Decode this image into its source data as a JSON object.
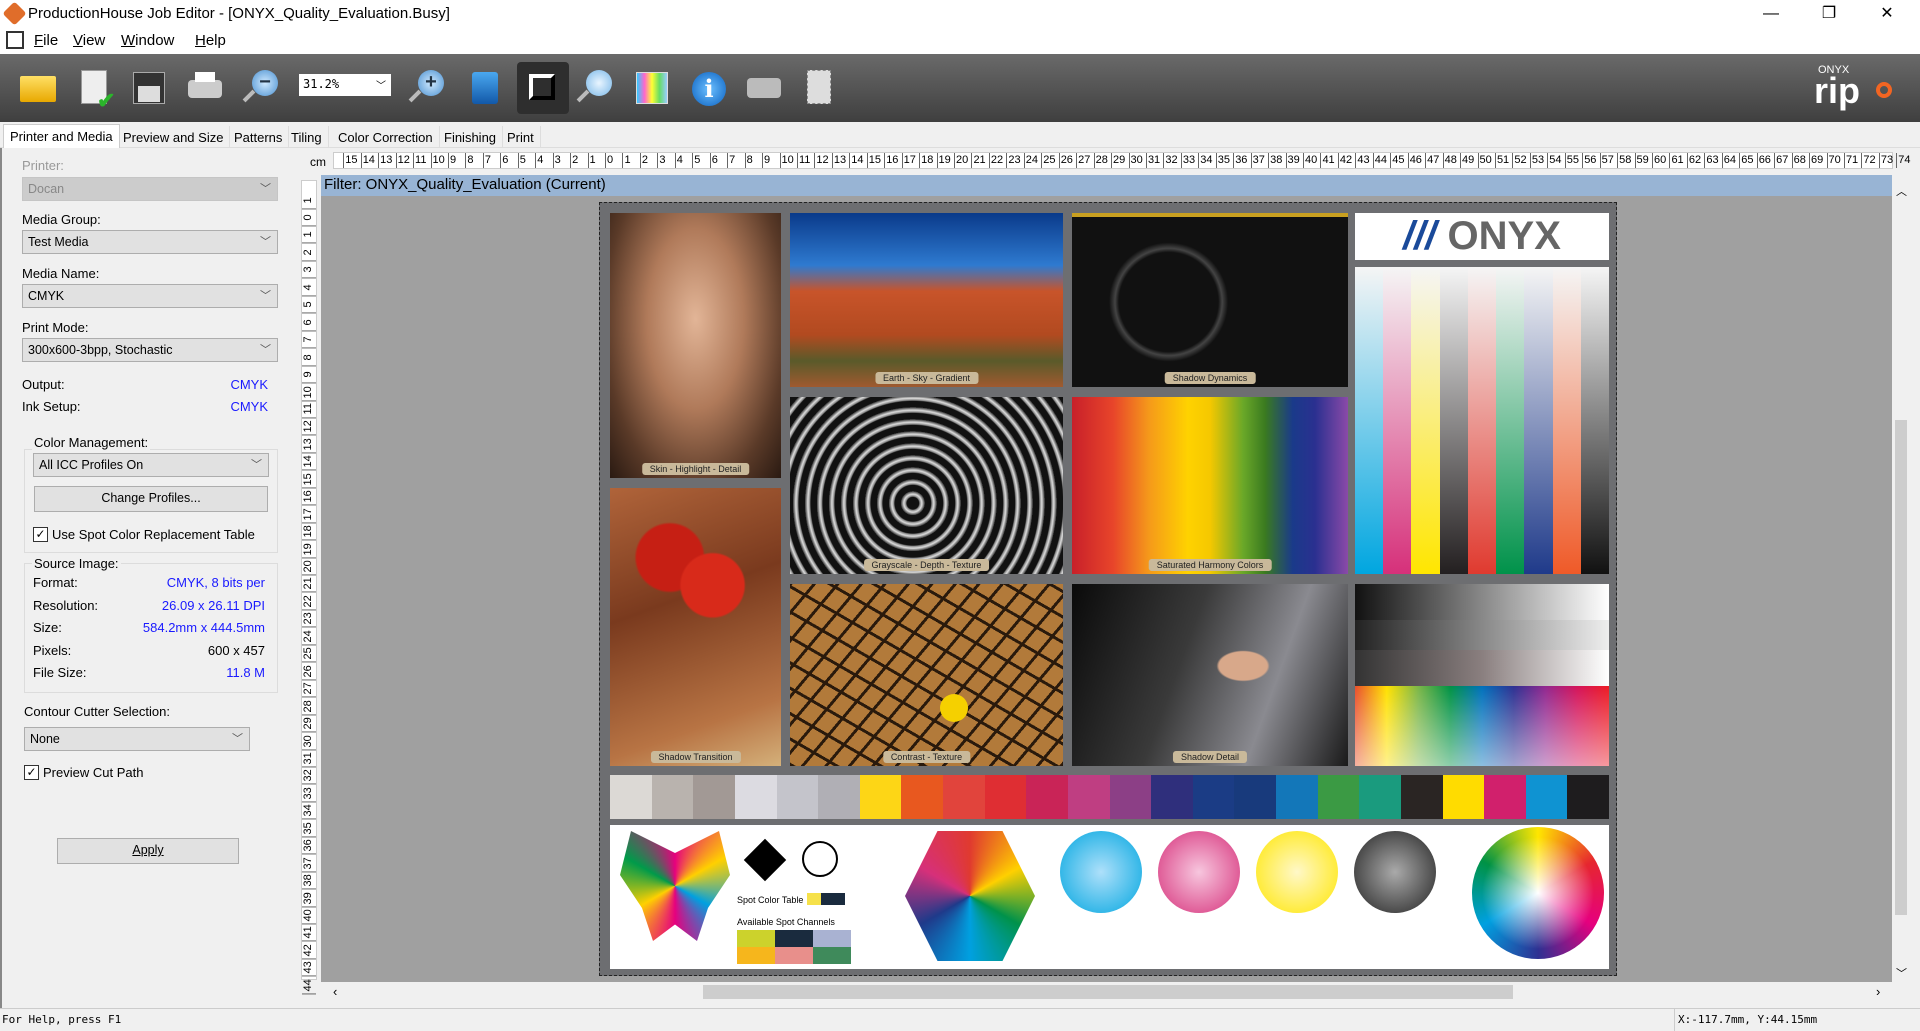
{
  "window": {
    "title": "ProductionHouse Job Editor - [ONYX_Quality_Evaluation.Busy]",
    "minimize": "—",
    "restore": "❐",
    "close": "✕",
    "mdi_min": "_",
    "mdi_restore": "❐",
    "mdi_close": "✕"
  },
  "menu": [
    "File",
    "View",
    "Window",
    "Help"
  ],
  "toolbar": {
    "zoom_value": "31.2%",
    "icons": [
      "open-folder-icon",
      "job-properties-icon",
      "save-icon",
      "print-icon",
      "zoom-out-icon",
      "zoom-in-icon",
      "preview-icon",
      "crop-icon",
      "zoom-icon",
      "color-bars-icon",
      "info-icon",
      "printer-settings-icon",
      "tile-settings-icon"
    ],
    "brand": {
      "top": "ONYX",
      "main": "rip"
    }
  },
  "tabs": [
    "Printer and Media",
    "Preview and Size",
    "Patterns",
    "Tiling",
    "Color Correction",
    "Finishing",
    "Print"
  ],
  "active_tab": 0,
  "panel": {
    "printer_label": "Printer:",
    "printer_value": "Docan",
    "media_group_label": "Media Group:",
    "media_group_value": "Test Media",
    "media_name_label": "Media Name:",
    "media_name_value": "CMYK",
    "print_mode_label": "Print Mode:",
    "print_mode_value": "300x600-3bpp, Stochastic",
    "output_label": "Output:",
    "output_value": "CMYK",
    "ink_label": "Ink Setup:",
    "ink_value": "CMYK",
    "color_mgmt_label": "Color Management:",
    "color_mgmt_value": "All ICC Profiles On",
    "change_profiles": "Change Profiles...",
    "spot_table_label": "Use Spot Color Replacement Table",
    "spot_table_checked": true,
    "source_label": "Source Image:",
    "source": [
      {
        "label": "Format:",
        "value": "CMYK, 8 bits per",
        "link": true
      },
      {
        "label": "Resolution:",
        "value": "26.09 x 26.11 DPI",
        "link": true
      },
      {
        "label": "Size:",
        "value": "584.2mm x 444.5mm",
        "link": true
      },
      {
        "label": "Pixels:",
        "value": "600 x 457",
        "link": false
      },
      {
        "label": "File Size:",
        "value": "11.8 M",
        "link": true
      }
    ],
    "contour_label": "Contour Cutter Selection:",
    "contour_value": "None",
    "preview_cut_label": "Preview Cut Path",
    "preview_cut_checked": true,
    "apply": "Apply"
  },
  "ruler": {
    "unit": "cm",
    "h_min": -15,
    "h_max": 74,
    "v_min": -1,
    "v_max": 44
  },
  "filter_bar": "Filter: ONYX_Quality_Evaluation (Current)",
  "print": {
    "logo": "ONYX",
    "captions": {
      "face": "Skin - Highlight - Detail",
      "desert": "Earth - Sky - Gradient",
      "car": "Shadow Dynamics",
      "stairs": "Grayscale - Depth - Texture",
      "fruit": "Saturated Harmony Colors",
      "tomato": "Shadow Transition",
      "cracks": "Contrast - Texture",
      "woman": "Shadow Detail"
    },
    "spot_color_table": "Spot Color Table",
    "available_spot_channels": "Available Spot Channels",
    "color_columns": [
      "#00a6e0",
      "#d6307a",
      "#ffe600",
      "#231f20",
      "#e03a2f",
      "#00924a",
      "#1f3a8a",
      "#ef5a28",
      "#111111"
    ],
    "strip_colors": [
      "#dcd9d5",
      "#b9b3ae",
      "#a29995",
      "#dcdbe1",
      "#c4c4cb",
      "#b0afb5",
      "#fdd616",
      "#e8581f",
      "#e1443c",
      "#df2e33",
      "#c92457",
      "#bf3e82",
      "#8c3f86",
      "#2f2f7c",
      "#1b3c85",
      "#183a7c",
      "#1377b9",
      "#3b9a44",
      "#1a9b7e",
      "#2a2523",
      "#ffdc00",
      "#d1206c",
      "#0f93d2",
      "#1e1c1e"
    ],
    "spot_channels": [
      "#ccd22c",
      "#1a2b3e",
      "#a9b2d2",
      "#f6b61c",
      "#e88f8b",
      "#3f8a5b"
    ]
  },
  "status": {
    "help": "For Help, press F1",
    "coords": "X:-117.7mm, Y:44.15mm"
  }
}
